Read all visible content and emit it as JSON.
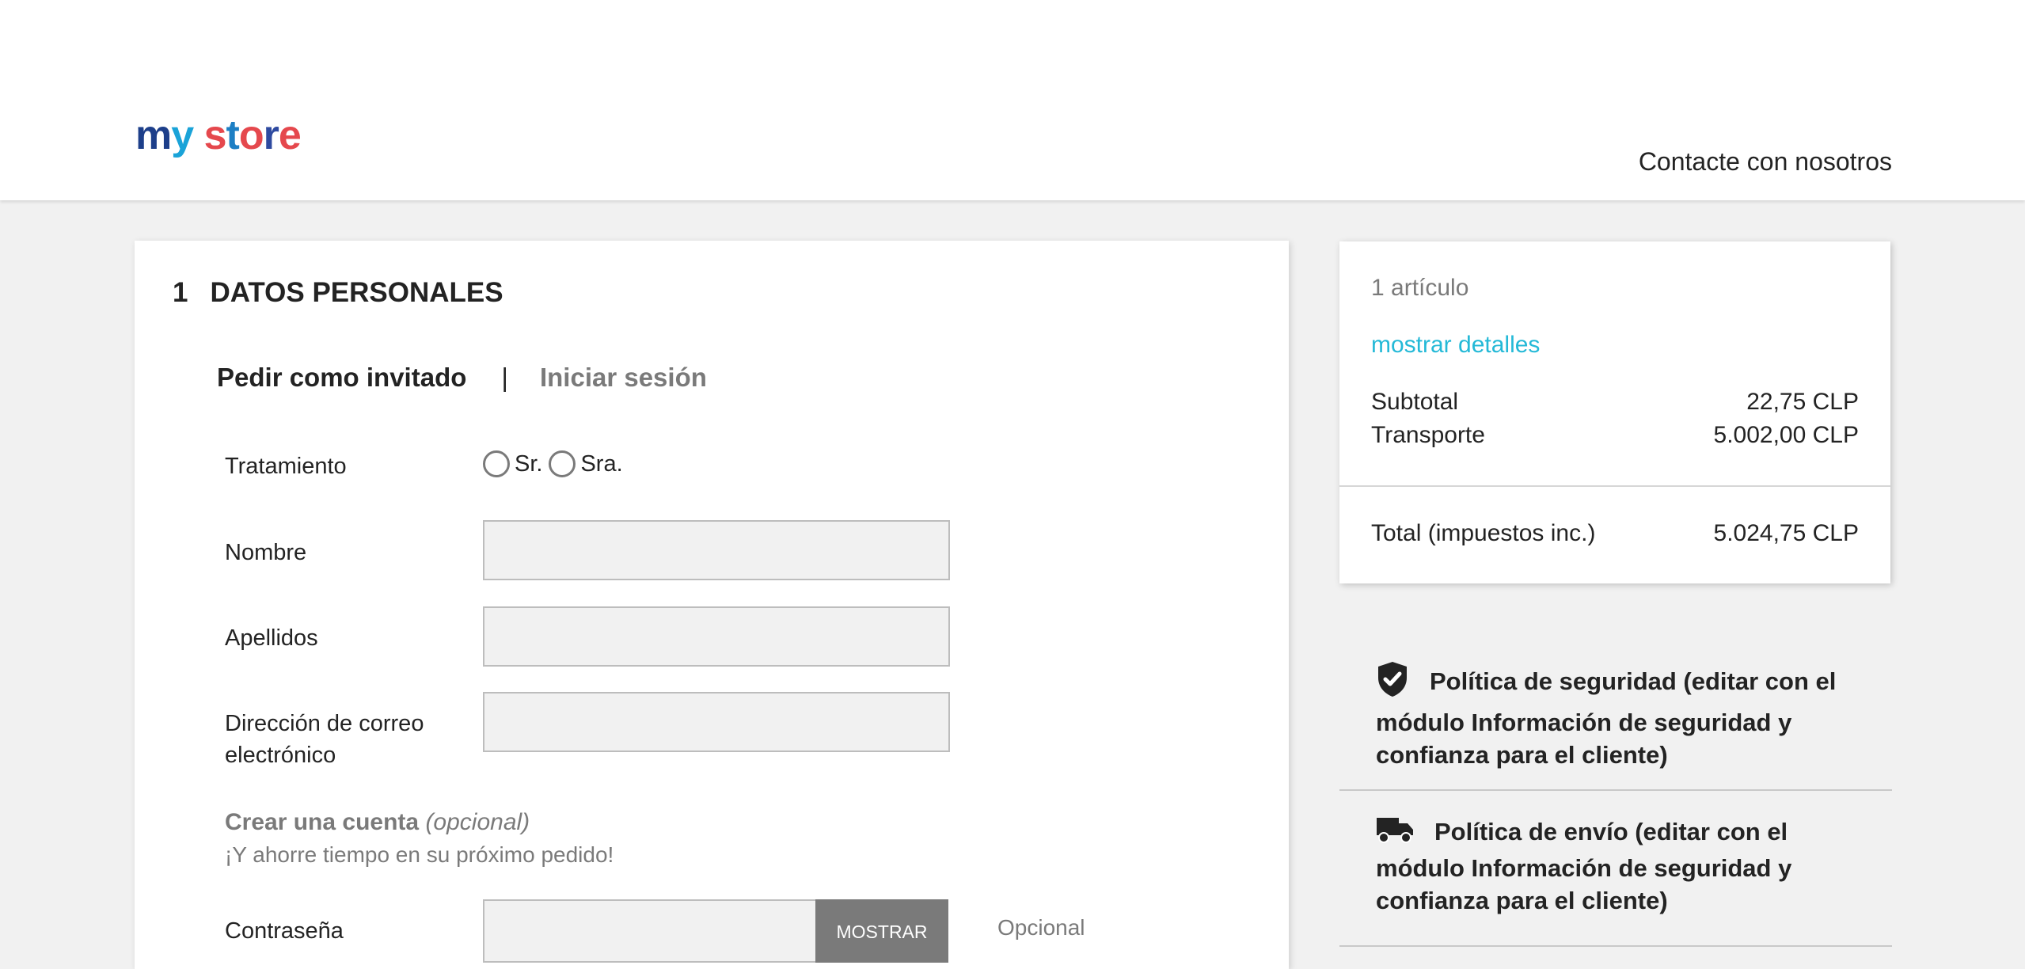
{
  "header": {
    "logo": [
      "m",
      "y",
      " ",
      "s",
      "t",
      "o",
      "r",
      "e"
    ],
    "contact_link": "Contacte con nosotros"
  },
  "checkout": {
    "step_number": "1",
    "step_title": "DATOS PERSONALES",
    "tab_guest": "Pedir como invitado",
    "tab_separator": "|",
    "tab_login": "Iniciar sesión",
    "fields": {
      "salutation_label": "Tratamiento",
      "option_mr": "Sr.",
      "option_mrs": "Sra.",
      "firstname_label": "Nombre",
      "lastname_label": "Apellidos",
      "email_label_line1": "Dirección de correo",
      "email_label_line2": "electrónico",
      "firstname_value": "",
      "lastname_value": "",
      "email_value": ""
    },
    "create_account_title": "Crear una cuenta",
    "create_account_optional": "(opcional)",
    "create_account_sub": "¡Y ahorre tiempo en su próximo pedido!",
    "password_label": "Contraseña",
    "show_button": "MOSTRAR",
    "optional_label": "Opcional"
  },
  "summary": {
    "item_count": "1 artículo",
    "details_link": "mostrar detalles",
    "subtotal_label": "Subtotal",
    "subtotal_value": "22,75 CLP",
    "shipping_label": "Transporte",
    "shipping_value": "5.002,00 CLP",
    "total_label": "Total (impuestos inc.)",
    "total_value": "5.024,75 CLP"
  },
  "reassurance": [
    {
      "icon": "shield-check-icon",
      "text": "Política de seguridad (editar con el módulo Información de seguridad y confianza para el cliente)"
    },
    {
      "icon": "truck-icon",
      "text": "Política de envío (editar con el módulo Información de seguridad y confianza para el cliente)"
    }
  ]
}
